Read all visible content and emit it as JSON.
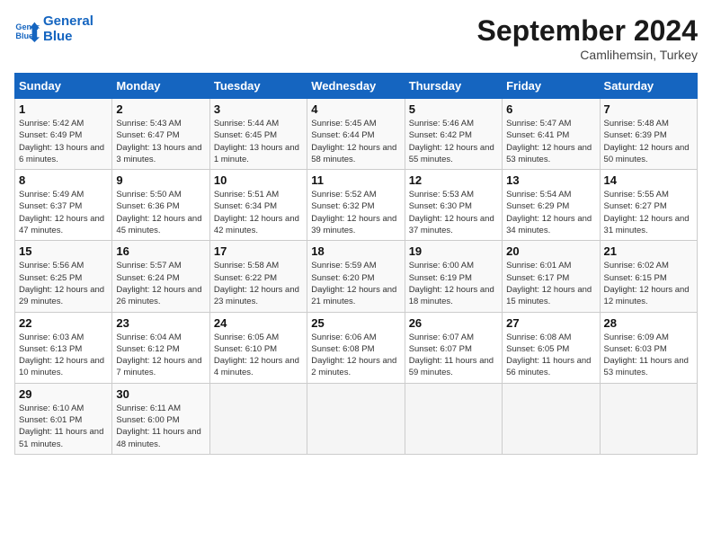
{
  "header": {
    "logo_line1": "General",
    "logo_line2": "Blue",
    "month": "September 2024",
    "location": "Camlihemsin, Turkey"
  },
  "days_of_week": [
    "Sunday",
    "Monday",
    "Tuesday",
    "Wednesday",
    "Thursday",
    "Friday",
    "Saturday"
  ],
  "weeks": [
    [
      {
        "day": "1",
        "rise": "5:42 AM",
        "set": "6:49 PM",
        "daylight": "13 hours and 6 minutes."
      },
      {
        "day": "2",
        "rise": "5:43 AM",
        "set": "6:47 PM",
        "daylight": "13 hours and 3 minutes."
      },
      {
        "day": "3",
        "rise": "5:44 AM",
        "set": "6:45 PM",
        "daylight": "13 hours and 1 minute."
      },
      {
        "day": "4",
        "rise": "5:45 AM",
        "set": "6:44 PM",
        "daylight": "12 hours and 58 minutes."
      },
      {
        "day": "5",
        "rise": "5:46 AM",
        "set": "6:42 PM",
        "daylight": "12 hours and 55 minutes."
      },
      {
        "day": "6",
        "rise": "5:47 AM",
        "set": "6:41 PM",
        "daylight": "12 hours and 53 minutes."
      },
      {
        "day": "7",
        "rise": "5:48 AM",
        "set": "6:39 PM",
        "daylight": "12 hours and 50 minutes."
      }
    ],
    [
      {
        "day": "8",
        "rise": "5:49 AM",
        "set": "6:37 PM",
        "daylight": "12 hours and 47 minutes."
      },
      {
        "day": "9",
        "rise": "5:50 AM",
        "set": "6:36 PM",
        "daylight": "12 hours and 45 minutes."
      },
      {
        "day": "10",
        "rise": "5:51 AM",
        "set": "6:34 PM",
        "daylight": "12 hours and 42 minutes."
      },
      {
        "day": "11",
        "rise": "5:52 AM",
        "set": "6:32 PM",
        "daylight": "12 hours and 39 minutes."
      },
      {
        "day": "12",
        "rise": "5:53 AM",
        "set": "6:30 PM",
        "daylight": "12 hours and 37 minutes."
      },
      {
        "day": "13",
        "rise": "5:54 AM",
        "set": "6:29 PM",
        "daylight": "12 hours and 34 minutes."
      },
      {
        "day": "14",
        "rise": "5:55 AM",
        "set": "6:27 PM",
        "daylight": "12 hours and 31 minutes."
      }
    ],
    [
      {
        "day": "15",
        "rise": "5:56 AM",
        "set": "6:25 PM",
        "daylight": "12 hours and 29 minutes."
      },
      {
        "day": "16",
        "rise": "5:57 AM",
        "set": "6:24 PM",
        "daylight": "12 hours and 26 minutes."
      },
      {
        "day": "17",
        "rise": "5:58 AM",
        "set": "6:22 PM",
        "daylight": "12 hours and 23 minutes."
      },
      {
        "day": "18",
        "rise": "5:59 AM",
        "set": "6:20 PM",
        "daylight": "12 hours and 21 minutes."
      },
      {
        "day": "19",
        "rise": "6:00 AM",
        "set": "6:19 PM",
        "daylight": "12 hours and 18 minutes."
      },
      {
        "day": "20",
        "rise": "6:01 AM",
        "set": "6:17 PM",
        "daylight": "12 hours and 15 minutes."
      },
      {
        "day": "21",
        "rise": "6:02 AM",
        "set": "6:15 PM",
        "daylight": "12 hours and 12 minutes."
      }
    ],
    [
      {
        "day": "22",
        "rise": "6:03 AM",
        "set": "6:13 PM",
        "daylight": "12 hours and 10 minutes."
      },
      {
        "day": "23",
        "rise": "6:04 AM",
        "set": "6:12 PM",
        "daylight": "12 hours and 7 minutes."
      },
      {
        "day": "24",
        "rise": "6:05 AM",
        "set": "6:10 PM",
        "daylight": "12 hours and 4 minutes."
      },
      {
        "day": "25",
        "rise": "6:06 AM",
        "set": "6:08 PM",
        "daylight": "12 hours and 2 minutes."
      },
      {
        "day": "26",
        "rise": "6:07 AM",
        "set": "6:07 PM",
        "daylight": "11 hours and 59 minutes."
      },
      {
        "day": "27",
        "rise": "6:08 AM",
        "set": "6:05 PM",
        "daylight": "11 hours and 56 minutes."
      },
      {
        "day": "28",
        "rise": "6:09 AM",
        "set": "6:03 PM",
        "daylight": "11 hours and 53 minutes."
      }
    ],
    [
      {
        "day": "29",
        "rise": "6:10 AM",
        "set": "6:01 PM",
        "daylight": "11 hours and 51 minutes."
      },
      {
        "day": "30",
        "rise": "6:11 AM",
        "set": "6:00 PM",
        "daylight": "11 hours and 48 minutes."
      },
      null,
      null,
      null,
      null,
      null
    ]
  ]
}
